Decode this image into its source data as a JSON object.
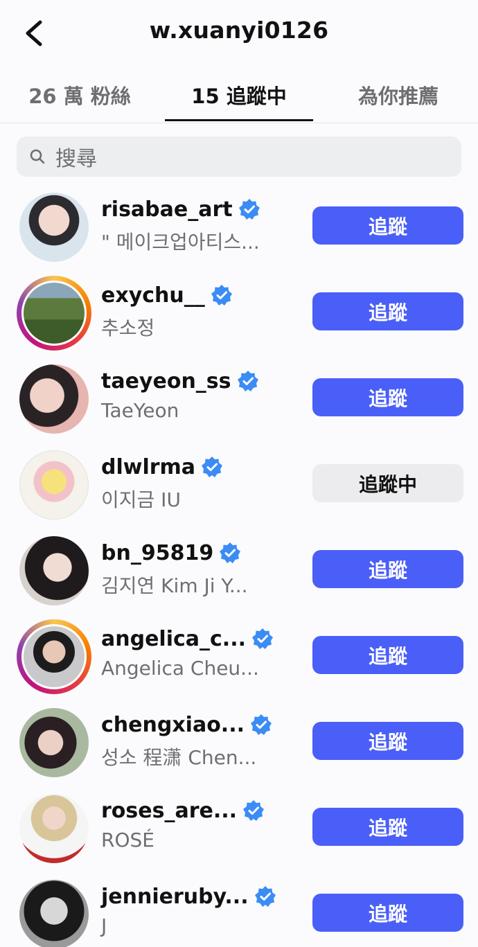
{
  "header": {
    "title": "w.xuanyi0126"
  },
  "tabs": {
    "followers": "26 萬 粉絲",
    "following": "15 追蹤中",
    "suggested": "為你推薦"
  },
  "search": {
    "placeholder": "搜尋"
  },
  "accounts": [
    {
      "username": "risabae_art",
      "subtitle": "\" 메이크업아티스...",
      "button": "追蹤",
      "state": "follow",
      "story_ring": false
    },
    {
      "username": "exychu__",
      "subtitle": "추소정",
      "button": "追蹤",
      "state": "follow",
      "story_ring": true
    },
    {
      "username": "taeyeon_ss",
      "subtitle": "TaeYeon",
      "button": "追蹤",
      "state": "follow",
      "story_ring": false
    },
    {
      "username": "dlwlrma",
      "subtitle": "이지금 IU",
      "button": "追蹤中",
      "state": "following",
      "story_ring": false
    },
    {
      "username": "bn_95819",
      "subtitle": "김지연 Kim Ji Y...",
      "button": "追蹤",
      "state": "follow",
      "story_ring": false
    },
    {
      "username": "angelica_c...",
      "subtitle": "Angelica Cheu...",
      "button": "追蹤",
      "state": "follow",
      "story_ring": true
    },
    {
      "username": "chengxiao...",
      "subtitle": "성소 程潇 Chen...",
      "button": "追蹤",
      "state": "follow",
      "story_ring": false
    },
    {
      "username": "roses_are...",
      "subtitle": "ROSÉ",
      "button": "追蹤",
      "state": "follow",
      "story_ring": false
    },
    {
      "username": "jennieruby...",
      "subtitle": "J",
      "button": "追蹤",
      "state": "follow",
      "story_ring": false
    }
  ],
  "colors": {
    "follow_button": "#4a5ff7",
    "following_button": "#ececee",
    "verified_badge": "#3b8cf5"
  }
}
